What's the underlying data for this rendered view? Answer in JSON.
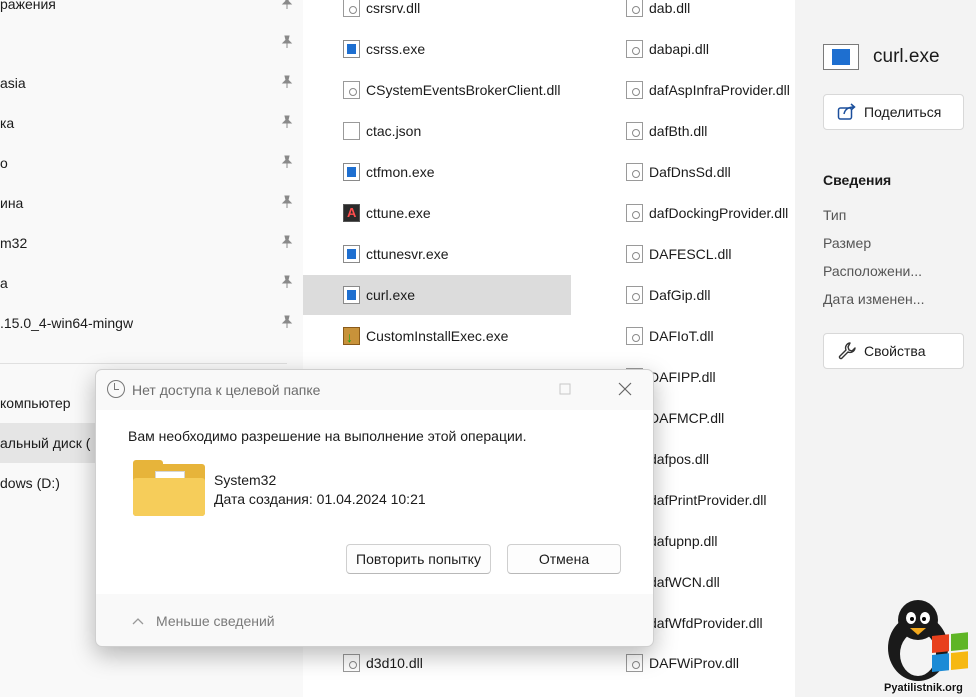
{
  "nav": {
    "items": [
      {
        "label": "ражения"
      },
      {
        "label": ""
      },
      {
        "label": "asia"
      },
      {
        "label": "ка"
      },
      {
        "label": "о"
      },
      {
        "label": "ина"
      },
      {
        "label": "m32"
      },
      {
        "label": "а"
      },
      {
        "label": ".15.0_4-win64-mingw"
      }
    ],
    "computer": "компьютер",
    "local_disk": "альный диск (",
    "windows_d": "dows (D:)"
  },
  "files": {
    "col1": [
      {
        "name": "csrsrv.dll",
        "icon": "dll-icon"
      },
      {
        "name": "csrss.exe",
        "icon": "exe-icon"
      },
      {
        "name": "CSystemEventsBrokerClient.dll",
        "icon": "dll-icon"
      },
      {
        "name": "ctac.json",
        "icon": "json-icon"
      },
      {
        "name": "ctfmon.exe",
        "icon": "exe-icon"
      },
      {
        "name": "cttune.exe",
        "icon": "cttune-icon"
      },
      {
        "name": "cttunesvr.exe",
        "icon": "exe-icon"
      },
      {
        "name": "curl.exe",
        "icon": "exe-icon",
        "selected": true
      },
      {
        "name": "CustomInstallExec.exe",
        "icon": "installer-icon"
      },
      {
        "name": "d3d10.dll",
        "icon": "dll-icon"
      }
    ],
    "col2": [
      {
        "name": "dab.dll"
      },
      {
        "name": "dabapi.dll"
      },
      {
        "name": "dafAspInfraProvider.dll"
      },
      {
        "name": "dafBth.dll"
      },
      {
        "name": "DafDnsSd.dll"
      },
      {
        "name": "dafDockingProvider.dll"
      },
      {
        "name": "DAFESCL.dll"
      },
      {
        "name": "DafGip.dll"
      },
      {
        "name": "DAFIoT.dll"
      },
      {
        "name": "DAFIPP.dll"
      },
      {
        "name": "DAFMCP.dll"
      },
      {
        "name": "dafpos.dll"
      },
      {
        "name": "dafPrintProvider.dll"
      },
      {
        "name": "dafupnp.dll"
      },
      {
        "name": "dafWCN.dll"
      },
      {
        "name": "dafWfdProvider.dll"
      },
      {
        "name": "DAFWiProv.dll"
      }
    ]
  },
  "details": {
    "filename": "curl.exe",
    "share_label": "Поделиться",
    "section_title": "Сведения",
    "props": [
      "Тип",
      "Размер",
      "Расположени...",
      "Дата изменен..."
    ],
    "properties_label": "Свойства"
  },
  "dialog": {
    "title": "Нет доступа к целевой папке",
    "message": "Вам необходимо разрешение на выполнение этой операции.",
    "folder_name": "System32",
    "folder_date": "Дата создания: 01.04.2024 10:21",
    "retry_label": "Повторить попытку",
    "cancel_label": "Отмена",
    "footer_label": "Меньше сведений"
  },
  "watermark": {
    "text": "Pyatilistnik.org"
  }
}
